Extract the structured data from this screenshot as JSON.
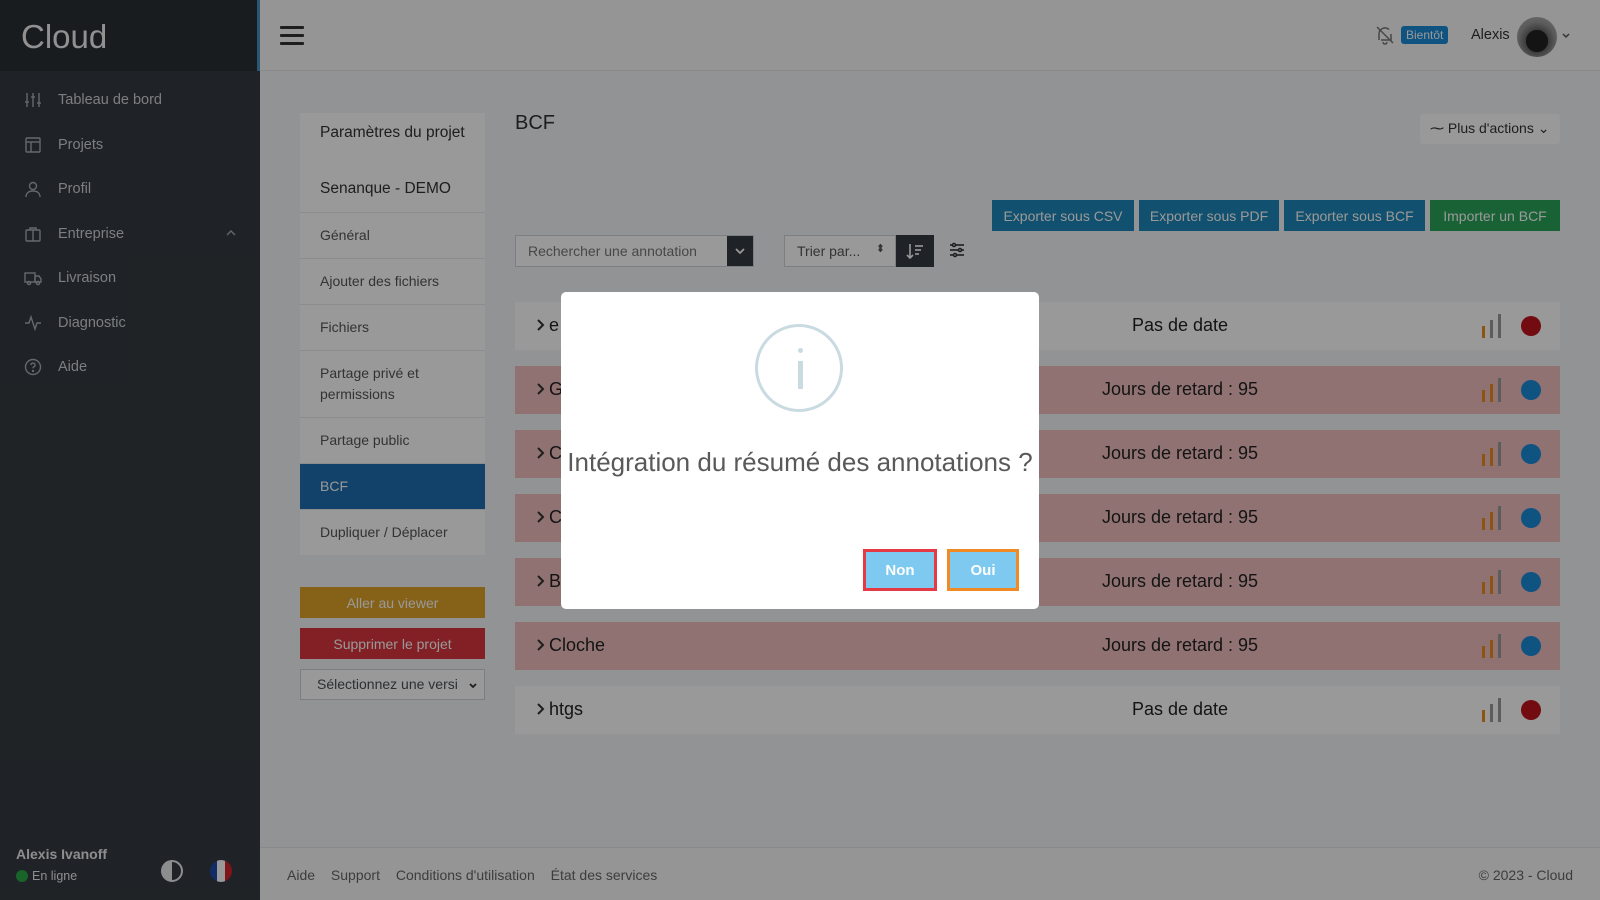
{
  "app": {
    "brand": "Cloud"
  },
  "sidebar": {
    "items": [
      {
        "label": "Tableau de bord",
        "icon": "sliders-icon"
      },
      {
        "label": "Projets",
        "icon": "layout-icon"
      },
      {
        "label": "Profil",
        "icon": "user-icon"
      },
      {
        "label": "Entreprise",
        "icon": "briefcase-icon"
      },
      {
        "label": "Livraison",
        "icon": "truck-icon"
      },
      {
        "label": "Diagnostic",
        "icon": "activity-icon"
      },
      {
        "label": "Aide",
        "icon": "help-circle-icon"
      }
    ],
    "user_name": "Alexis Ivanoff",
    "status": "En ligne"
  },
  "topbar": {
    "badge": "Bientôt",
    "user": "Alexis"
  },
  "settings": {
    "title": "Paramètres du projet",
    "project": "Senanque - DEMO",
    "items": [
      "Général",
      "Ajouter des fichiers",
      "Fichiers",
      "Partage privé et permissions",
      "Partage public",
      "BCF",
      "Dupliquer / Déplacer"
    ],
    "go_viewer": "Aller au viewer",
    "delete_project": "Supprimer le projet",
    "version_placeholder": "Sélectionnez une versi"
  },
  "main": {
    "title": "BCF",
    "more_actions": "Plus d'actions",
    "exports": [
      "Exporter sous CSV",
      "Exporter sous PDF",
      "Exporter sous BCF",
      "Importer un BCF"
    ],
    "search_placeholder": "Rechercher une annotation",
    "sort_placeholder": "Trier par...",
    "rows": [
      {
        "name": "e",
        "date": "Pas de date",
        "late": false,
        "status_color": "#c0151b"
      },
      {
        "name": "G",
        "date": "Jours de retard : 95",
        "late": true,
        "status_color": "#1a8ad8"
      },
      {
        "name": "C",
        "date": "Jours de retard : 95",
        "late": true,
        "status_color": "#1a8ad8"
      },
      {
        "name": "C",
        "date": "Jours de retard : 95",
        "late": true,
        "status_color": "#1a8ad8"
      },
      {
        "name": "B",
        "date": "Jours de retard : 95",
        "late": true,
        "status_color": "#1a8ad8"
      },
      {
        "name": "Cloche",
        "date": "Jours de retard : 95",
        "late": true,
        "status_color": "#1a8ad8"
      },
      {
        "name": "htgs",
        "date": "Pas de date",
        "late": false,
        "status_color": "#c0151b"
      }
    ]
  },
  "footer": {
    "links": [
      "Aide",
      "Support",
      "Conditions d'utilisation",
      "État des services"
    ],
    "copyright": "© 2023 - Cloud"
  },
  "modal": {
    "message": "Intégration du résumé des annotations ?",
    "no": "Non",
    "yes": "Oui"
  },
  "colors": {
    "sidebar_bg": "#343a40",
    "active_blue": "#1e6fb0",
    "export_blue": "#1d86b7",
    "import_green": "#2aa45a",
    "late_row": "#f0bfbe"
  }
}
